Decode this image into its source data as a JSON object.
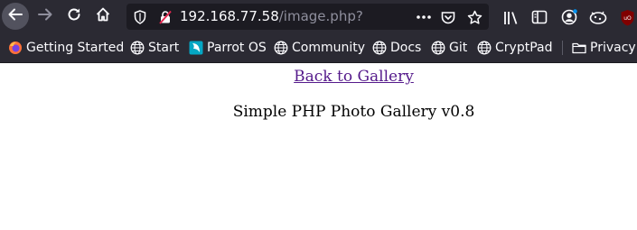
{
  "browser": {
    "url_host": "192.168.77.58",
    "url_path": "/image.php?",
    "icons": {
      "back": "back-arrow-icon",
      "forward": "forward-arrow-icon",
      "reload": "reload-icon",
      "home": "home-icon",
      "tracking": "shield-icon",
      "insecure": "insecure-lock-icon",
      "page_actions": "more-dots-icon",
      "pocket": "pocket-icon",
      "bookmark": "star-icon",
      "library": "library-icon",
      "sidebar": "sidebar-icon",
      "account": "account-icon",
      "extension": "cookie-icon",
      "ublock": "ublock-icon"
    }
  },
  "bookmarks": [
    {
      "label": "Getting Started",
      "icon": "firefox-icon"
    },
    {
      "label": "Start",
      "icon": "globe-icon"
    },
    {
      "label": "Parrot OS",
      "icon": "parrot-icon"
    },
    {
      "label": "Community",
      "icon": "globe-icon"
    },
    {
      "label": "Docs",
      "icon": "globe-icon"
    },
    {
      "label": "Git",
      "icon": "globe-icon"
    },
    {
      "label": "CryptPad",
      "icon": "globe-icon"
    },
    {
      "label": "Privacy",
      "icon": "folder-icon"
    }
  ],
  "page": {
    "back_link": "Back to Gallery",
    "title": "Simple PHP Photo Gallery v0.8"
  },
  "colors": {
    "toolbar_bg": "#2b2a33",
    "urlbar_bg": "#1c1b22",
    "visited_link": "#551a8b",
    "ublock_red": "#800000"
  }
}
